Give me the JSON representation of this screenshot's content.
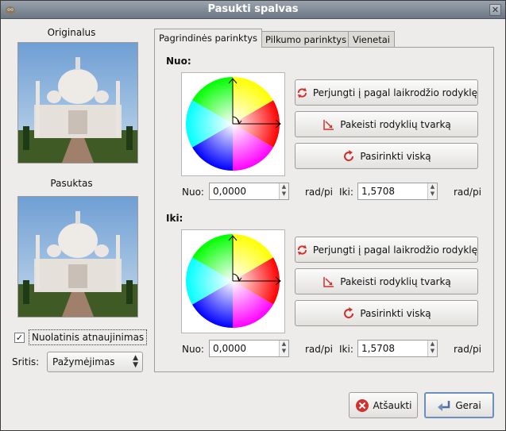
{
  "window": {
    "title": "Pasukti spalvas",
    "close_glyph": "✕"
  },
  "previews": {
    "original_label": "Originalus",
    "rotated_label": "Pasuktas"
  },
  "options": {
    "continuous_update_label": "Nuolatinis atnaujinimas",
    "continuous_update_checked": true,
    "check_glyph": "✓",
    "area_label": "Sritis:",
    "area_value": "Pažymėjimas",
    "combo_arrows": "▲▼"
  },
  "tabs": [
    {
      "label": "Pagrindinės parinktys",
      "active": true
    },
    {
      "label": "Pilkumo parinktys",
      "active": false
    },
    {
      "label": "Vienetai",
      "active": false
    }
  ],
  "from": {
    "title": "Nuo:",
    "button_switch": "Perjungti į pagal laikrodžio rodyklę",
    "button_swap": "Pakeisti rodyklių tvarką",
    "button_select_all": "Pasirinkti viską",
    "start_label": "Nuo:",
    "start_value": "0,0000",
    "start_unit": "rad/pi",
    "end_label": "Iki:",
    "end_value": "1,5708",
    "end_unit": "rad/pi"
  },
  "to": {
    "title": "Iki:",
    "button_switch": "Perjungti į pagal laikrodžio rodyklę",
    "button_swap": "Pakeisti rodyklių tvarką",
    "button_select_all": "Pasirinkti viską",
    "start_label": "Nuo:",
    "start_value": "0,0000",
    "start_unit": "rad/pi",
    "end_label": "Iki:",
    "end_value": "1,5708",
    "end_unit": "rad/pi"
  },
  "stepper_glyph": "▲▼",
  "footer": {
    "cancel_label": "Atšaukti",
    "ok_label": "Gerai"
  },
  "colors": {
    "titlebar": "#7b8590",
    "accent_red": "#d0312d",
    "ok_border": "#6d8fbf"
  }
}
